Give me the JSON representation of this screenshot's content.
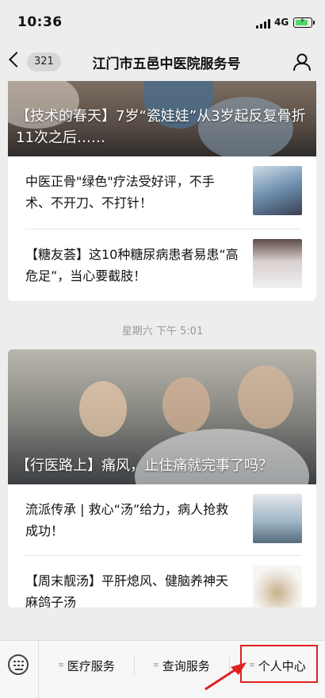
{
  "status_bar": {
    "time": "10:36",
    "network": "4G",
    "battery_level": 0.85,
    "battery_color": "#4cd964"
  },
  "nav": {
    "unread_count": "321",
    "title": "江门市五邑中医院服务号",
    "back_icon": "chevron-left-icon",
    "profile_icon": "person-icon"
  },
  "article_group_1": {
    "hero_title": "【技术的春天】7岁“瓷娃娃”从3岁起反复骨折11次之后……",
    "items": [
      {
        "title": "中医正骨\"绿色\"疗法受好评，不手术、不开刀、不打针！"
      },
      {
        "title": "【糖友荟】这10种糖尿病患者易患“高危足”，当心要截肢！"
      }
    ]
  },
  "timestamp": "星期六 下午 5:01",
  "article_group_2": {
    "hero_title": "【行医路上】痛风，止住痛就完事了吗？",
    "items": [
      {
        "title": "流派传承 | 救心“汤”给力，病人抢救成功！"
      },
      {
        "title": "【周末靓汤】平肝熄风、健脑养神天麻鸽子汤"
      }
    ]
  },
  "bottom_menu": {
    "keyboard_icon": "keyboard-icon",
    "items": [
      {
        "label": "医疗服务"
      },
      {
        "label": "查询服务"
      },
      {
        "label": "个人中心"
      }
    ],
    "highlight_color": "#e02020"
  }
}
